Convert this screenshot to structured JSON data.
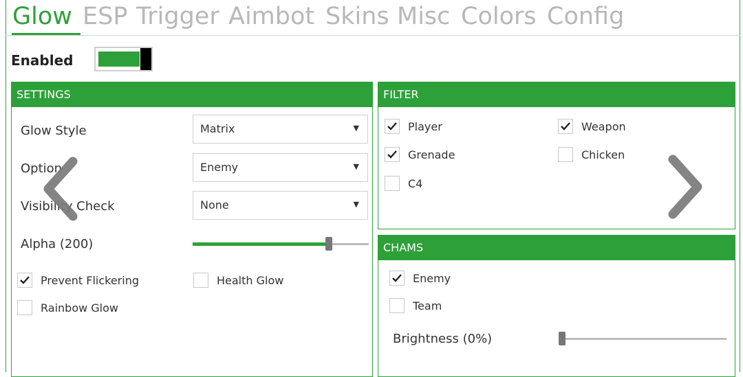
{
  "tabs": [
    {
      "label": "Glow",
      "active": true
    },
    {
      "label": "ESP",
      "active": false
    },
    {
      "label": "Trigger",
      "active": false
    },
    {
      "label": "Aimbot",
      "active": false
    },
    {
      "label": "Skins",
      "active": false
    },
    {
      "label": "Misc",
      "active": false
    },
    {
      "label": "Colors",
      "active": false
    },
    {
      "label": "Config",
      "active": false
    }
  ],
  "enabled": {
    "label": "Enabled",
    "on": true
  },
  "settings": {
    "title": "SETTINGS",
    "glow_style": {
      "label": "Glow Style",
      "value": "Matrix"
    },
    "option": {
      "label": "Option",
      "value": "Enemy"
    },
    "visibility": {
      "label": "Visibility Check",
      "value": "None"
    },
    "alpha": {
      "label": "Alpha (200)",
      "value": 200,
      "max": 255
    },
    "prevent_flickering": {
      "label": "Prevent Flickering",
      "checked": true
    },
    "health_glow": {
      "label": "Health Glow",
      "checked": false
    },
    "rainbow_glow": {
      "label": "Rainbow Glow",
      "checked": false
    }
  },
  "filter": {
    "title": "FILTER",
    "player": {
      "label": "Player",
      "checked": true
    },
    "weapon": {
      "label": "Weapon",
      "checked": true
    },
    "grenade": {
      "label": "Grenade",
      "checked": true
    },
    "chicken": {
      "label": "Chicken",
      "checked": false
    },
    "c4": {
      "label": "C4",
      "checked": false
    }
  },
  "chams": {
    "title": "CHAMS",
    "enemy": {
      "label": "Enemy",
      "checked": true
    },
    "team": {
      "label": "Team",
      "checked": false
    },
    "brightness": {
      "label": "Brightness (0%)",
      "value": 0
    }
  },
  "colors": {
    "accent": "#2ea03a",
    "inactive_tab": "#b8b8b8"
  },
  "icons": {
    "left": "chevron-left-icon",
    "right": "chevron-right-icon",
    "check": "check-icon",
    "dropdown": "caret-down-icon"
  }
}
